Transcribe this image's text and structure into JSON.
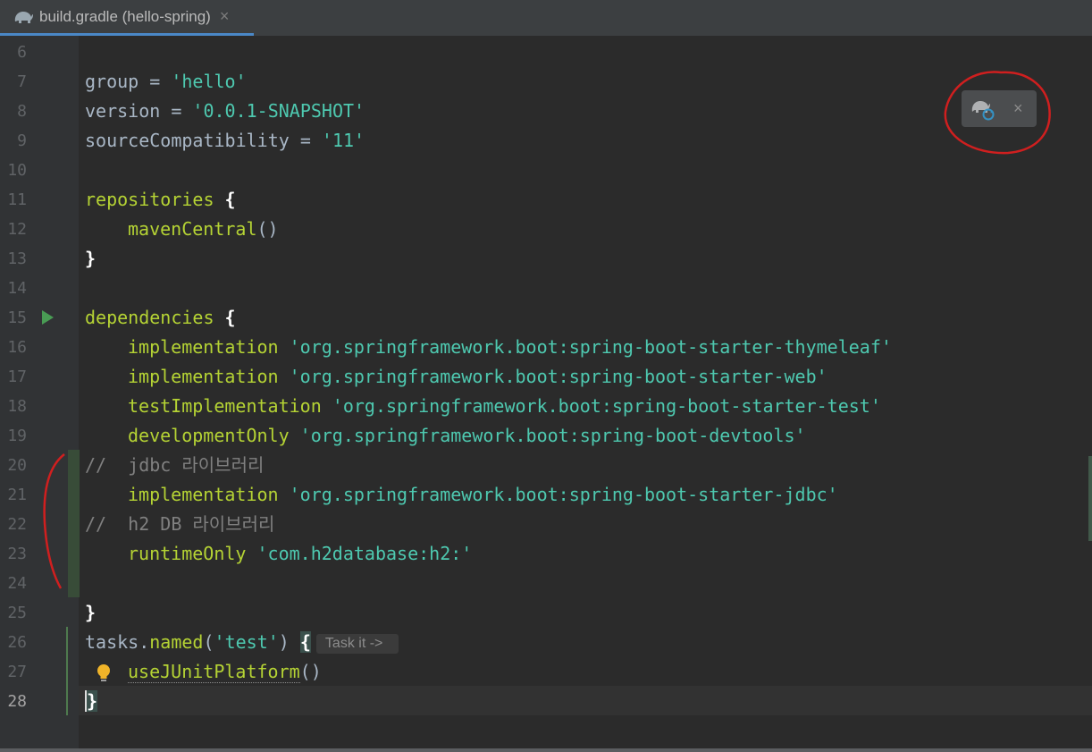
{
  "tab": {
    "title": "build.gradle (hello-spring)",
    "close": "×",
    "icon": "gradle-elephant-icon"
  },
  "gradle_popup": {
    "sync_icon": "gradle-sync-icon",
    "close": "×"
  },
  "line_numbers": [
    "6",
    "7",
    "8",
    "9",
    "10",
    "11",
    "12",
    "13",
    "14",
    "15",
    "16",
    "17",
    "18",
    "19",
    "20",
    "21",
    "22",
    "23",
    "24",
    "25",
    "26",
    "27",
    "28"
  ],
  "code": {
    "l7_a": "group",
    "l7_b": " = ",
    "l7_c": "'hello'",
    "l8_a": "version",
    "l8_b": " = ",
    "l8_c": "'0.0.1-SNAPSHOT'",
    "l9_a": "sourceCompatibility",
    "l9_b": " = ",
    "l9_c": "'11'",
    "l11_a": "repositories",
    "l11_b": " {",
    "l12_a": "mavenCentral",
    "l12_b": "()",
    "l13": "}",
    "l15_a": "dependencies",
    "l15_b": " {",
    "l16_a": "implementation",
    "l16_b": "'org.springframework.boot:spring-boot-starter-thymeleaf'",
    "l17_a": "implementation",
    "l17_b": "'org.springframework.boot:spring-boot-starter-web'",
    "l18_a": "testImplementation",
    "l18_b": "'org.springframework.boot:spring-boot-starter-test'",
    "l19_a": "developmentOnly",
    "l19_b": "'org.springframework.boot:spring-boot-devtools'",
    "l20": "//  jdbc 라이브러리",
    "l21_a": "implementation",
    "l21_b": "'org.springframework.boot:spring-boot-starter-jdbc'",
    "l22": "//  h2 DB 라이브러리",
    "l23_a": "runtimeOnly",
    "l23_b": "'com.h2database:h2:'",
    "l25": "}",
    "l26_a": "tasks",
    "l26_b": ".",
    "l26_c": "named",
    "l26_d": "(",
    "l26_e": "'test'",
    "l26_f": ") ",
    "l26_g": "{",
    "l26_hint": "Task it ->",
    "l27_a": "useJUnitPlatform",
    "l27_b": "()",
    "l28": "}"
  }
}
